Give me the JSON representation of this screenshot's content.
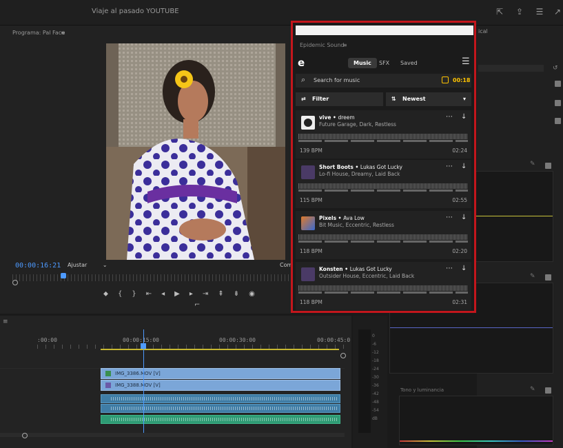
{
  "window": {
    "title": "Viaje al pasado YOUTUBE"
  },
  "program_monitor": {
    "header": "Programa: Pal Face",
    "timecode": "00:00:16:21",
    "fit": "Ajustar",
    "cut_label": "Com"
  },
  "right_panel": {
    "tab": "ical",
    "scope_label": "Tono y luminancia"
  },
  "timeline": {
    "marks": [
      ":00:00",
      "00:00:15:00",
      "00:00:30:00",
      "00:00:45:0"
    ],
    "clips": [
      {
        "name": "IMG_3386.MOV [V]"
      },
      {
        "name": "IMG_3388.MOV [V]"
      }
    ]
  },
  "meter": {
    "labels": [
      "0",
      "-6",
      "-12",
      "-18",
      "-24",
      "-30",
      "-36",
      "-42",
      "-48",
      "-54",
      "dB"
    ]
  },
  "epidemic": {
    "panel_title": "Epidemic Sound",
    "logo": "e",
    "tabs": [
      "Music",
      "SFX",
      "Saved"
    ],
    "search_placeholder": "Search for music",
    "search_duration": "00:18",
    "filter_label": "Filter",
    "sort_label": "Newest",
    "tracks": [
      {
        "title": "vive",
        "artist": "dreem",
        "tags": "Future Garage, Dark, Restless",
        "bpm": "139 BPM",
        "duration": "02:24",
        "thumb_color": "#f0f0f0"
      },
      {
        "title": "Short Boots",
        "artist": "Lukas Got Lucky",
        "tags": "Lo-fi House, Dreamy, Laid Back",
        "bpm": "115 BPM",
        "duration": "02:55",
        "thumb_color": "#4a3a66"
      },
      {
        "title": "Pixels",
        "artist": "Ava Low",
        "tags": "Bit Music, Eccentric, Restless",
        "bpm": "118 BPM",
        "duration": "02:20",
        "thumb_color": "#e07a2a"
      },
      {
        "title": "Konsten",
        "artist": "Lukas Got Lucky",
        "tags": "Outsider House, Eccentric, Laid Back",
        "bpm": "118 BPM",
        "duration": "02:31",
        "thumb_color": "#4a3a66"
      }
    ]
  }
}
